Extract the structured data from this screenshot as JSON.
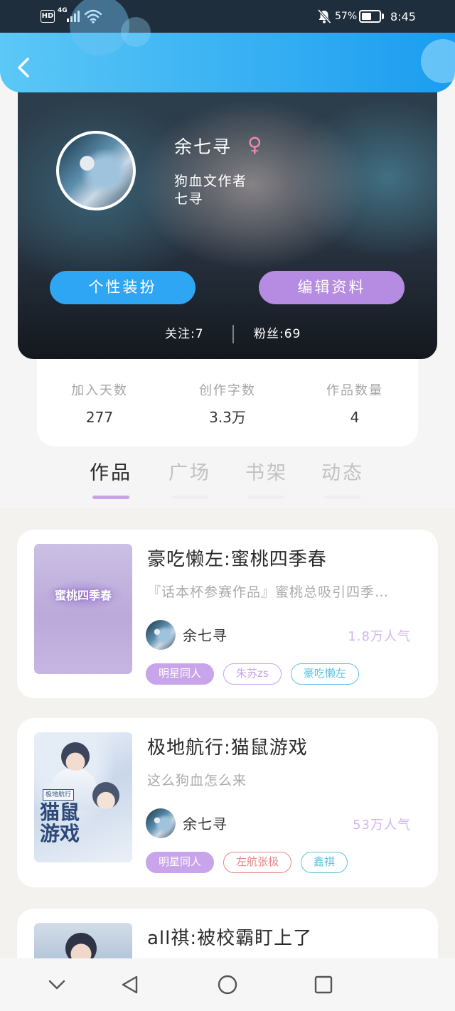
{
  "status_bar": {
    "hd": "HD",
    "network": "4G",
    "battery_percent": "57%",
    "battery_level": 0.57,
    "time": "8:45",
    "icons": [
      "signal-icon",
      "wifi-icon",
      "mute-bell-icon",
      "battery-icon"
    ]
  },
  "header": {
    "back_icon": "chevron-left-icon"
  },
  "profile": {
    "name": "余七寻",
    "gender_symbol": "♀",
    "bio_line1": "狗血文作者",
    "bio_line2": "七寻",
    "decorate_button": "个性装扮",
    "edit_button": "编辑资料",
    "following": "关注:7",
    "followers": "粉丝:69"
  },
  "stats": [
    {
      "label": "加入天数",
      "value": "277"
    },
    {
      "label": "创作字数",
      "value": "3.3万"
    },
    {
      "label": "作品数量",
      "value": "4"
    }
  ],
  "tabs": [
    {
      "label": "作品",
      "active": true
    },
    {
      "label": "广场",
      "active": false
    },
    {
      "label": "书架",
      "active": false
    },
    {
      "label": "动态",
      "active": false
    }
  ],
  "works": [
    {
      "title": "豪吃懒左:蜜桃四季春",
      "description": "『话本杯参赛作品』蜜桃总吸引四季…",
      "author": "余七寻",
      "popularity": "1.8万人气",
      "cover_title": "蜜桃四季春",
      "tags": [
        {
          "label": "明星同人",
          "color": "#c8a4ea",
          "filled": true
        },
        {
          "label": "朱苏zs",
          "color": "#c8a4ea",
          "filled": false
        },
        {
          "label": "豪吃懒左",
          "color": "#5cc3de",
          "filled": false
        }
      ]
    },
    {
      "title": "极地航行:猫鼠游戏",
      "description": "这么狗血怎么来",
      "author": "余七寻",
      "popularity": "53万人气",
      "cover_badge": "极地航行",
      "cover_title": "猫鼠游戏",
      "tags": [
        {
          "label": "明星同人",
          "color": "#c8a4ea",
          "filled": true
        },
        {
          "label": "左航张极",
          "color": "#e58787",
          "filled": false
        },
        {
          "label": "鑫祺",
          "color": "#5cc3de",
          "filled": false
        }
      ]
    },
    {
      "title": "all祺:被校霸盯上了"
    }
  ],
  "nav_bar": {
    "icons": [
      "chevron-down-icon",
      "back-triangle-icon",
      "home-circle-icon",
      "recents-square-icon"
    ]
  },
  "colors": {
    "header_start": "#5bc8f6",
    "header_end": "#1b9cf0",
    "decorate_button": "#2ea6f4",
    "edit_button": "#b68ce2",
    "popularity": "#d3b5ef",
    "gender": "#ee89aa",
    "tab_accent": "#c7a4e8"
  }
}
